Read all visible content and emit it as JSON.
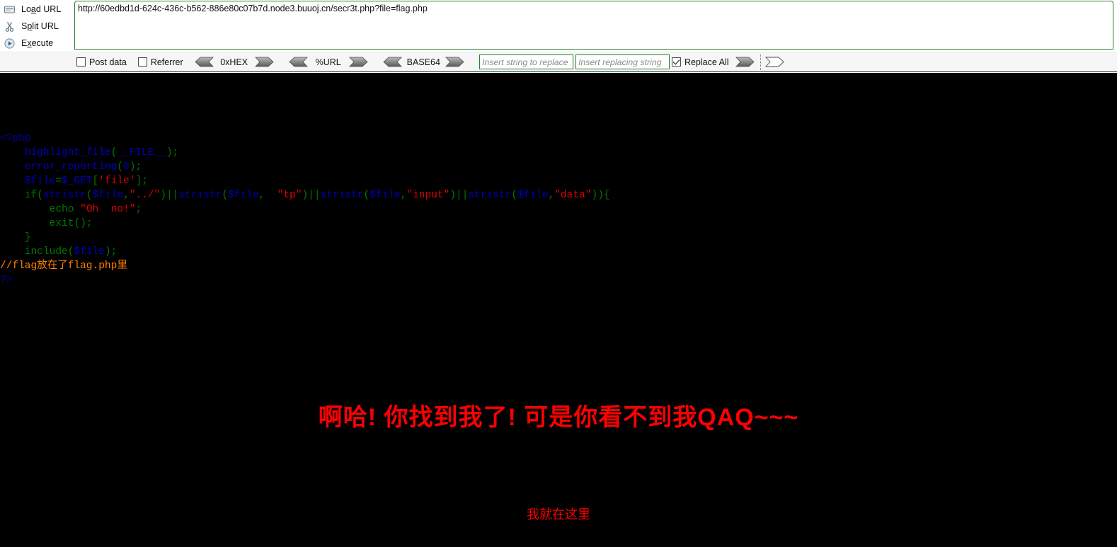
{
  "hackbar": {
    "actions": [
      {
        "icon": "load-url-icon",
        "label_pre": "Lo",
        "label_accel": "a",
        "label_post": "d URL",
        "name": "load-url"
      },
      {
        "icon": "scissors-icon",
        "label_pre": "S",
        "label_accel": "p",
        "label_post": "lit URL",
        "name": "split-url"
      },
      {
        "icon": "play-icon",
        "label_pre": "E",
        "label_accel": "x",
        "label_post": "ecute",
        "name": "execute"
      }
    ],
    "url_value": "http://60edbd1d-624c-436c-b562-886e80c07b7d.node3.buuoj.cn/secr3t.php?file=flag.php",
    "url_placeholder": "",
    "checkboxes": [
      {
        "label": "Post data",
        "checked": false,
        "name": "post-data"
      },
      {
        "label": "Referrer",
        "checked": false,
        "name": "referrer"
      }
    ],
    "encoders": [
      {
        "label": "0xHEX",
        "name": "hex"
      },
      {
        "label": "%URL",
        "name": "url"
      },
      {
        "label": "BASE64",
        "name": "base64"
      }
    ],
    "replace_search_placeholder": "Insert string to replace",
    "replace_search_value": "",
    "replace_with_placeholder": "Insert replacing string",
    "replace_with_value": "",
    "replace_all": {
      "label": "Replace All",
      "checked": true
    }
  },
  "page": {
    "code_lines": [
      [
        {
          "t": "<?php",
          "c": "c-php"
        }
      ],
      [
        {
          "t": "    ",
          "c": "c-def"
        },
        {
          "t": "highlight_file",
          "c": "c-fn"
        },
        {
          "t": "(",
          "c": "c-kw"
        },
        {
          "t": "__FILE__",
          "c": "c-fn"
        },
        {
          "t": ");",
          "c": "c-kw"
        }
      ],
      [
        {
          "t": "    ",
          "c": "c-def"
        },
        {
          "t": "error_reporting",
          "c": "c-fn"
        },
        {
          "t": "(",
          "c": "c-kw"
        },
        {
          "t": "0",
          "c": "c-fn"
        },
        {
          "t": ");",
          "c": "c-kw"
        }
      ],
      [
        {
          "t": "    ",
          "c": "c-def"
        },
        {
          "t": "$file",
          "c": "c-fn"
        },
        {
          "t": "=",
          "c": "c-kw"
        },
        {
          "t": "$_GET",
          "c": "c-fn"
        },
        {
          "t": "[",
          "c": "c-kw"
        },
        {
          "t": "'file'",
          "c": "c-str"
        },
        {
          "t": "];",
          "c": "c-kw"
        }
      ],
      [
        {
          "t": "    ",
          "c": "c-def"
        },
        {
          "t": "if",
          "c": "c-kw"
        },
        {
          "t": "(",
          "c": "c-kw"
        },
        {
          "t": "stristr",
          "c": "c-fn"
        },
        {
          "t": "(",
          "c": "c-kw"
        },
        {
          "t": "$file",
          "c": "c-fn"
        },
        {
          "t": ",",
          "c": "c-kw"
        },
        {
          "t": "\"../\"",
          "c": "c-str"
        },
        {
          "t": ")||",
          "c": "c-kw"
        },
        {
          "t": "stristr",
          "c": "c-fn"
        },
        {
          "t": "(",
          "c": "c-kw"
        },
        {
          "t": "$file",
          "c": "c-fn"
        },
        {
          "t": ",  ",
          "c": "c-kw"
        },
        {
          "t": "\"tp\"",
          "c": "c-str"
        },
        {
          "t": ")||",
          "c": "c-kw"
        },
        {
          "t": "stristr",
          "c": "c-fn"
        },
        {
          "t": "(",
          "c": "c-kw"
        },
        {
          "t": "$file",
          "c": "c-fn"
        },
        {
          "t": ",",
          "c": "c-kw"
        },
        {
          "t": "\"input\"",
          "c": "c-str"
        },
        {
          "t": ")||",
          "c": "c-kw"
        },
        {
          "t": "stristr",
          "c": "c-fn"
        },
        {
          "t": "(",
          "c": "c-kw"
        },
        {
          "t": "$file",
          "c": "c-fn"
        },
        {
          "t": ",",
          "c": "c-kw"
        },
        {
          "t": "\"data\"",
          "c": "c-str"
        },
        {
          "t": ")){",
          "c": "c-kw"
        }
      ],
      [
        {
          "t": "        ",
          "c": "c-def"
        },
        {
          "t": "echo",
          "c": "c-kw"
        },
        {
          "t": " ",
          "c": "c-kw"
        },
        {
          "t": "\"Oh  no!\"",
          "c": "c-str"
        },
        {
          "t": ";",
          "c": "c-kw"
        }
      ],
      [
        {
          "t": "        ",
          "c": "c-def"
        },
        {
          "t": "exit",
          "c": "c-kw"
        },
        {
          "t": "();",
          "c": "c-kw"
        }
      ],
      [
        {
          "t": "    ",
          "c": "c-def"
        },
        {
          "t": "}",
          "c": "c-kw"
        }
      ],
      [
        {
          "t": "    ",
          "c": "c-def"
        },
        {
          "t": "include",
          "c": "c-kw"
        },
        {
          "t": "(",
          "c": "c-kw"
        },
        {
          "t": "$file",
          "c": "c-fn"
        },
        {
          "t": ");",
          "c": "c-kw"
        }
      ],
      [
        {
          "t": "//flag放在了flag.php里",
          "c": "c-cmt"
        }
      ],
      [
        {
          "t": "?>",
          "c": "c-php"
        }
      ]
    ],
    "found_text": "啊哈! 你找到我了! 可是你看不到我QAQ~~~",
    "here_text": "我就在这里"
  },
  "colors": {
    "page_bg": "#000000",
    "alert_red": "#FF0000",
    "input_border_green": "#2e7d32",
    "comment_orange": "#FF8000",
    "keyword_green": "#007700",
    "func_blue": "#0000BB",
    "string_red": "#DD0000",
    "php_tag_navy": "#000099"
  }
}
